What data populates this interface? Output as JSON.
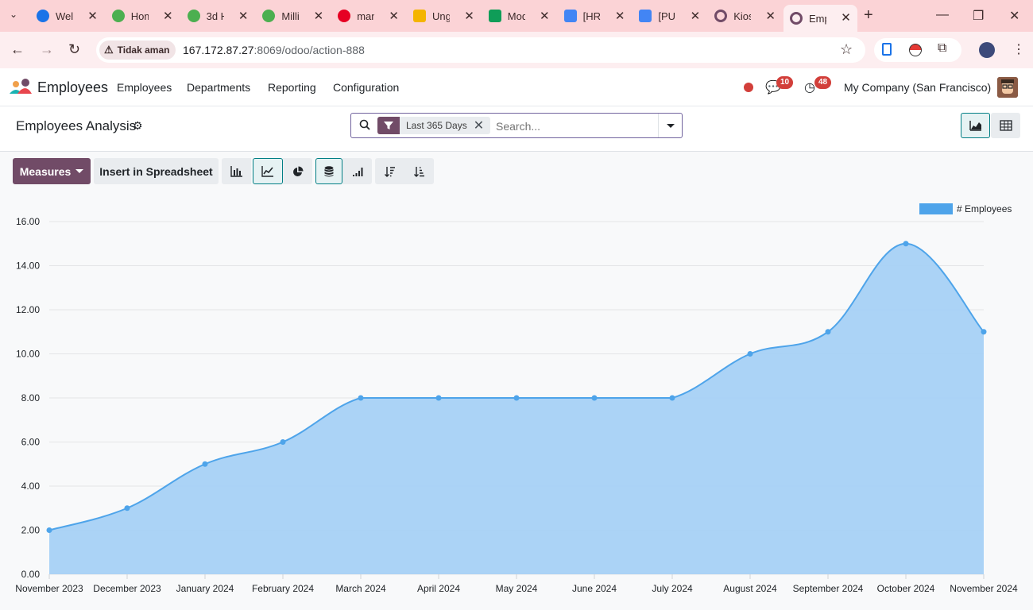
{
  "browser": {
    "tabs": [
      {
        "label": "Welc",
        "icon": "c-icon",
        "color": "#1a73e8"
      },
      {
        "label": "Hom",
        "icon": "odoo-green-icon",
        "color": "#4caf50"
      },
      {
        "label": "3d H",
        "icon": "odoo-green-icon",
        "color": "#4caf50"
      },
      {
        "label": "Millic",
        "icon": "odoo-green-icon",
        "color": "#4caf50"
      },
      {
        "label": "man",
        "icon": "pinterest-icon",
        "color": "#e60023"
      },
      {
        "label": "Ungi",
        "icon": "grad-cap-icon",
        "color": "#f4b400"
      },
      {
        "label": "Mod",
        "icon": "sheets-icon",
        "color": "#0f9d58"
      },
      {
        "label": "[HR]",
        "icon": "docs-icon",
        "color": "#4285f4"
      },
      {
        "label": "[PUF",
        "icon": "docs-icon",
        "color": "#4285f4"
      },
      {
        "label": "Kios",
        "icon": "odoo-ring-icon",
        "color": "#714b67"
      },
      {
        "label": "Emp",
        "icon": "odoo-ring-icon",
        "color": "#714b67"
      }
    ],
    "security_label": "Tidak aman",
    "url_host": "167.172.87.27",
    "url_rest": ":8069/odoo/action-888"
  },
  "navbar": {
    "app_name": "Employees",
    "menu": [
      "Employees",
      "Departments",
      "Reporting",
      "Configuration"
    ],
    "messages_count": "10",
    "activities_count": "48",
    "company": "My Company (San Francisco)"
  },
  "control_panel": {
    "title": "Employees Analysis",
    "facet": "Last 365 Days",
    "search_placeholder": "Search..."
  },
  "toolbar": {
    "measures_label": "Measures",
    "spreadsheet_label": "Insert in Spreadsheet"
  },
  "colors": {
    "accent": "#714b67",
    "teal": "#017e84",
    "series_line": "#4ea4ea",
    "series_fill": "#a6d1f6"
  },
  "chart_data": {
    "type": "area",
    "categories": [
      "November 2023",
      "December 2023",
      "January 2024",
      "February 2024",
      "March 2024",
      "April 2024",
      "May 2024",
      "June 2024",
      "July 2024",
      "August 2024",
      "September 2024",
      "October 2024",
      "November 2024"
    ],
    "series": [
      {
        "name": "# Employees",
        "values": [
          2,
          3,
          5,
          6,
          8,
          8,
          8,
          8,
          8,
          10,
          11,
          15,
          11
        ]
      }
    ],
    "yticks": [
      "0.00",
      "2.00",
      "4.00",
      "6.00",
      "8.00",
      "10.00",
      "12.00",
      "14.00",
      "16.00"
    ],
    "ylim": [
      0,
      16
    ],
    "grid": true,
    "legend": "top-right"
  }
}
